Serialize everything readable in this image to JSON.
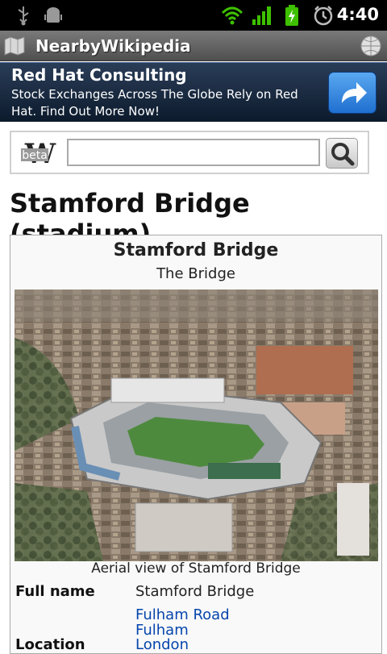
{
  "status_bar": {
    "time": "4:40",
    "icons": [
      "usb-icon",
      "android-debug-icon",
      "wifi-icon",
      "signal-icon",
      "battery-charging-icon",
      "alarm-icon"
    ]
  },
  "app": {
    "title": "NearbyWikipedia"
  },
  "ad": {
    "title": "Red Hat Consulting",
    "text": "Stock Exchanges Across The Globe Rely on Red Hat. Find Out More Now!"
  },
  "search": {
    "logo_badge": "beta",
    "value": "",
    "placeholder": ""
  },
  "article": {
    "title": "Stamford Bridge (stadium)",
    "infobox": {
      "name": "Stamford Bridge",
      "nickname": "The Bridge",
      "caption": "Aerial view of Stamford Bridge",
      "full_name_label": "Full name",
      "full_name_value": "Stamford Bridge",
      "location_label": "Location",
      "location_links": [
        "Fulham Road",
        "Fulham",
        "London"
      ]
    }
  }
}
